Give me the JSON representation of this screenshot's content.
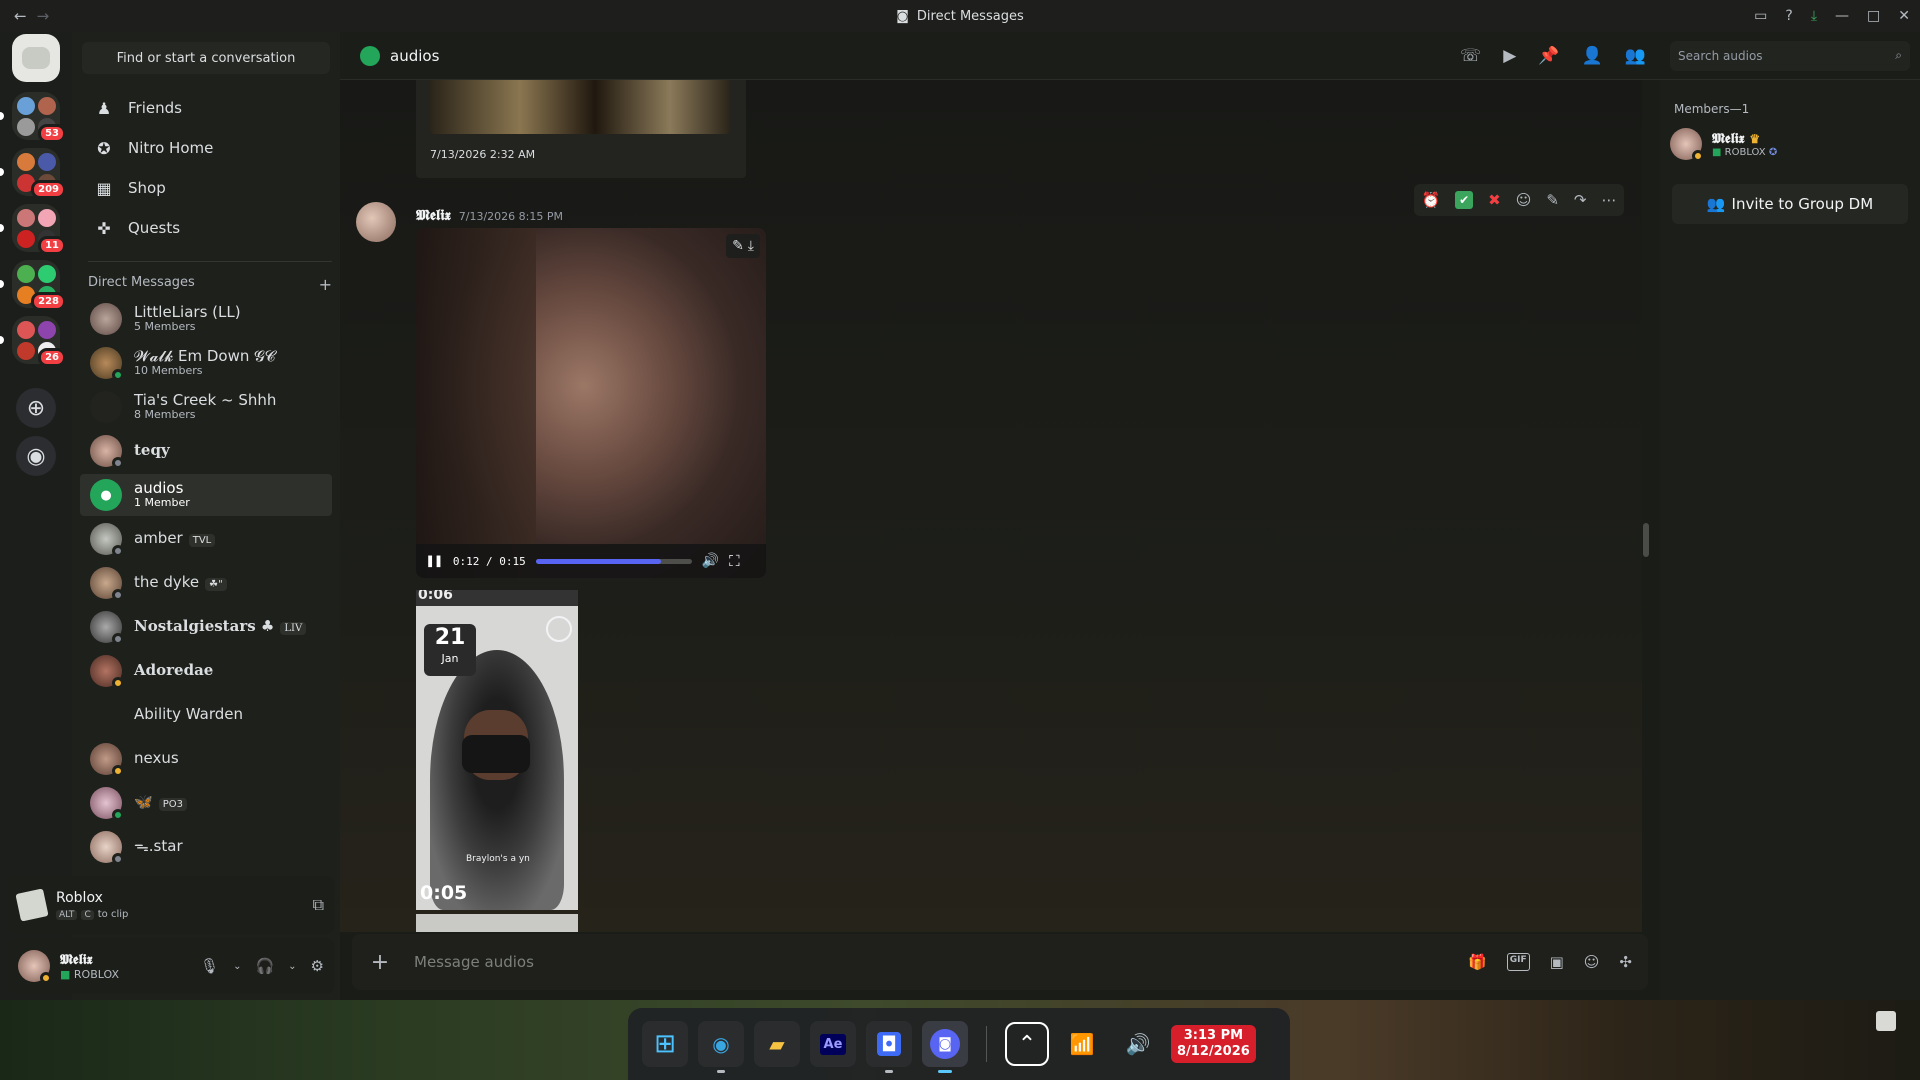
{
  "window": {
    "title": "Direct Messages"
  },
  "sidebar": {
    "search_label": "Find or start a conversation",
    "nav": [
      {
        "label": "Friends",
        "icon": "friends-icon"
      },
      {
        "label": "Nitro Home",
        "icon": "nitro-icon"
      },
      {
        "label": "Shop",
        "icon": "shop-icon"
      },
      {
        "label": "Quests",
        "icon": "quests-icon"
      }
    ],
    "dm_header": "Direct Messages",
    "dms": [
      {
        "name": "LittleLiars (LL)",
        "sub": "5 Members"
      },
      {
        "name": "𝓦𝓪𝓵𝓴 Em Down 𝓖𝓒",
        "sub": "10 Members"
      },
      {
        "name": "Tia's Creek ~ Shhh",
        "sub": "8 Members"
      },
      {
        "name": "teqy",
        "sub": ""
      },
      {
        "name": "audios",
        "sub": "1 Member"
      },
      {
        "name": "amber",
        "tag": "TVL"
      },
      {
        "name": "the dyke",
        "tag": "☘\""
      },
      {
        "name": "Nostalgiestars ♣",
        "tag": "LIV"
      },
      {
        "name": "Adoredae",
        "sub": ""
      },
      {
        "name": "Ability Warden",
        "sub": ""
      },
      {
        "name": "nexus",
        "sub": ""
      },
      {
        "name": "🦋",
        "tag": "PO3"
      },
      {
        "name": "ᯓ.star",
        "sub": ""
      }
    ],
    "rail_badges": [
      "53",
      "209",
      "11",
      "228",
      "26"
    ]
  },
  "activity": {
    "title": "Roblox",
    "key1": "ALT",
    "key2": "C",
    "hint": "to clip"
  },
  "user": {
    "name": "𝕸𝖊𝖑𝖎𝖝",
    "status": "ROBLOX"
  },
  "channel": {
    "name": "audios",
    "search_placeholder": "Search audios"
  },
  "messages": {
    "prev_timestamp": "7/13/2026 2:32 AM",
    "author": "𝕸𝖊𝖑𝖎𝖝",
    "timestamp": "7/13/2026 8:15 PM",
    "video": {
      "time": "0:12 / 0:15",
      "progress": 0.8
    },
    "thumb": {
      "top_time": "0:06",
      "day": "21",
      "month": "Jan",
      "duration": "0:05",
      "caption": "Braylon's a yn"
    }
  },
  "composer": {
    "placeholder": "Message audios",
    "gif_label": "GIF"
  },
  "members": {
    "header": "Members—1",
    "name": "𝕸𝖊𝖑𝖎𝖝",
    "status": "ROBLOX",
    "invite_label": "Invite to Group DM"
  },
  "taskbar": {
    "time": "3:13 PM",
    "date": "8/12/2026"
  }
}
